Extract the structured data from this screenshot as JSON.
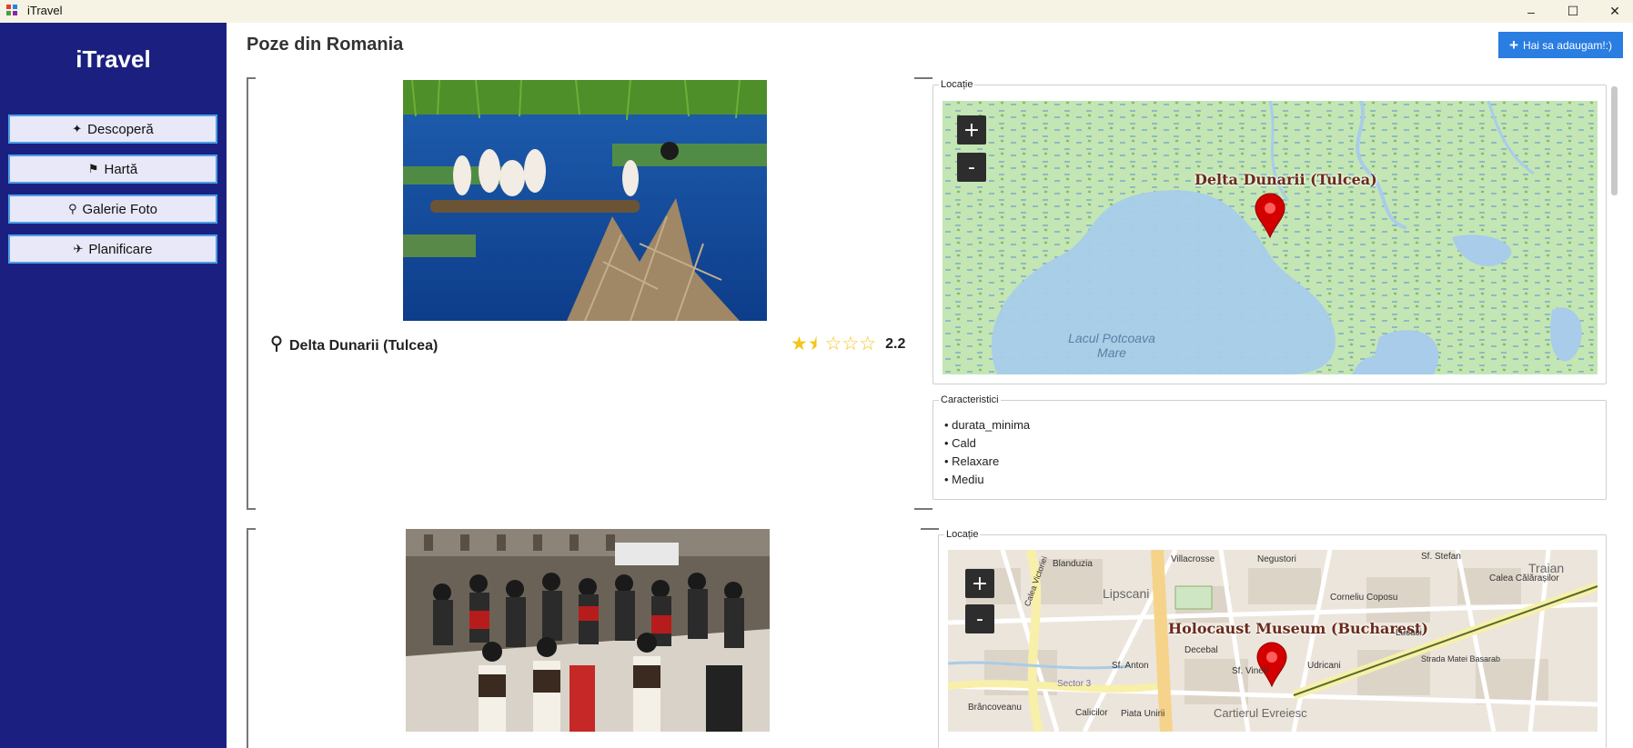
{
  "window": {
    "title": "iTravel",
    "minimize": "–",
    "maximize": "☐",
    "close": "✕"
  },
  "sidebar": {
    "brand": "iTravel",
    "items": [
      {
        "label": "Descoperă",
        "icon": "sparkle-icon",
        "glyph": "✦"
      },
      {
        "label": "Hartă",
        "icon": "flag-icon",
        "glyph": "⚑"
      },
      {
        "label": "Galerie Foto",
        "icon": "search-icon",
        "glyph": "⚲"
      },
      {
        "label": "Planificare",
        "icon": "airplane-icon",
        "glyph": "✈"
      }
    ]
  },
  "header": {
    "title": "Poze din Romania",
    "add_button": "Hai sa adaugam!:)"
  },
  "cards": [
    {
      "location": "Delta Dunarii (Tulcea)",
      "rating": "2.2",
      "rating_value": 2.2,
      "map_legend": "Locație",
      "map_label": "Delta Dunarii (Tulcea)",
      "map_water_label_1": "Lacul Potcoava",
      "map_water_label_2": "Mare",
      "features_legend": "Caracteristici",
      "features": [
        "• durata_minima",
        "• Cald",
        "• Relaxare",
        "• Mediu"
      ]
    },
    {
      "map_legend": "Locație",
      "map_label": "Holocaust Museum (Bucharest)",
      "streets": [
        "Blanduzia",
        "Villacrosse",
        "Negustori",
        "Sf. Stefan",
        "Traian",
        "Calea Călărașilor",
        "Lipscani",
        "Corneliu Coposu",
        "Decebal",
        "Sf. Anton",
        "Lucaci",
        "Udricani",
        "Sf. Vineri",
        "Brâncoveanu",
        "Calicilor",
        "Piata Unirii",
        "Cartierul Evreiesc",
        "Sector 3",
        "Strada Matei Basarab",
        "Calea Victoriei"
      ]
    }
  ],
  "zoom": {
    "in": "+",
    "out": "-"
  },
  "colors": {
    "sidebar": "#1b2080",
    "accent": "#2a7de1",
    "star": "#f5c518",
    "marker": "#d40000"
  }
}
